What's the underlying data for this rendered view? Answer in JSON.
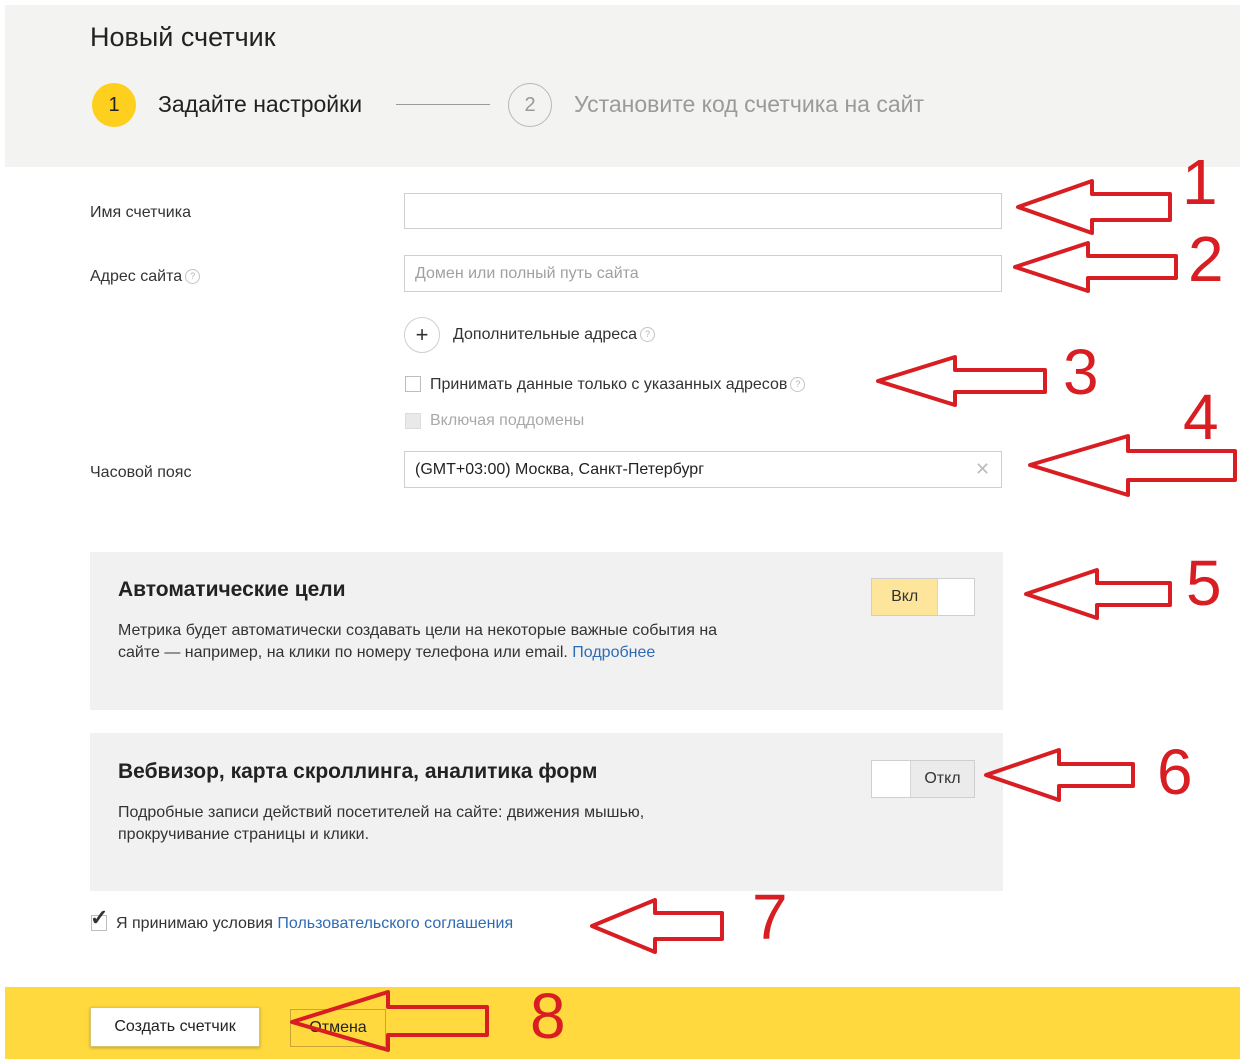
{
  "header": {
    "title": "Новый счетчик",
    "step1": {
      "number": "1",
      "label": "Задайте настройки"
    },
    "step2": {
      "number": "2",
      "label": "Установите код счетчика на сайт"
    }
  },
  "form": {
    "counter_name": {
      "label": "Имя счетчика",
      "value": ""
    },
    "site_address": {
      "label": "Адрес сайта",
      "placeholder": "Домен или полный путь сайта",
      "value": ""
    },
    "additional_addresses": {
      "plus": "+",
      "label": "Дополнительные адреса"
    },
    "only_specified": {
      "label": "Принимать данные только с указанных адресов",
      "checked": false
    },
    "include_subdomains": {
      "label": "Включая поддомены",
      "disabled": true
    },
    "timezone": {
      "label": "Часовой пояс",
      "value": "(GMT+03:00) Москва, Санкт-Петербург",
      "clear": "✕"
    },
    "help_glyph": "?"
  },
  "panels": {
    "auto_goals": {
      "title": "Автоматические цели",
      "desc_line1": "Метрика будет автоматически создавать цели на некоторые важные события на",
      "desc_line2": "сайте — например, на клики по номеру телефона или email.",
      "link": "Подробнее",
      "toggle_label": "Вкл",
      "toggle_state": "on"
    },
    "webvisor": {
      "title": "Вебвизор, карта скроллинга, аналитика форм",
      "desc_line1": "Подробные записи действий посетителей на сайте: движения мышью,",
      "desc_line2": "прокручивание страницы и клики.",
      "toggle_label": "Откл",
      "toggle_state": "off"
    }
  },
  "agreement": {
    "text": "Я принимаю условия",
    "link": "Пользовательского соглашения",
    "checked": true,
    "check_glyph": "✓"
  },
  "footer": {
    "create_label": "Создать счетчик",
    "cancel_label": "Отмена"
  },
  "annotations": {
    "color": "#d81e22",
    "numbers": [
      "1",
      "2",
      "3",
      "4",
      "5",
      "6",
      "7",
      "8"
    ]
  },
  "colors": {
    "accent_yellow": "#ffcf1e",
    "footer_yellow": "#ffd93d",
    "link_blue": "#2f6bb5"
  }
}
